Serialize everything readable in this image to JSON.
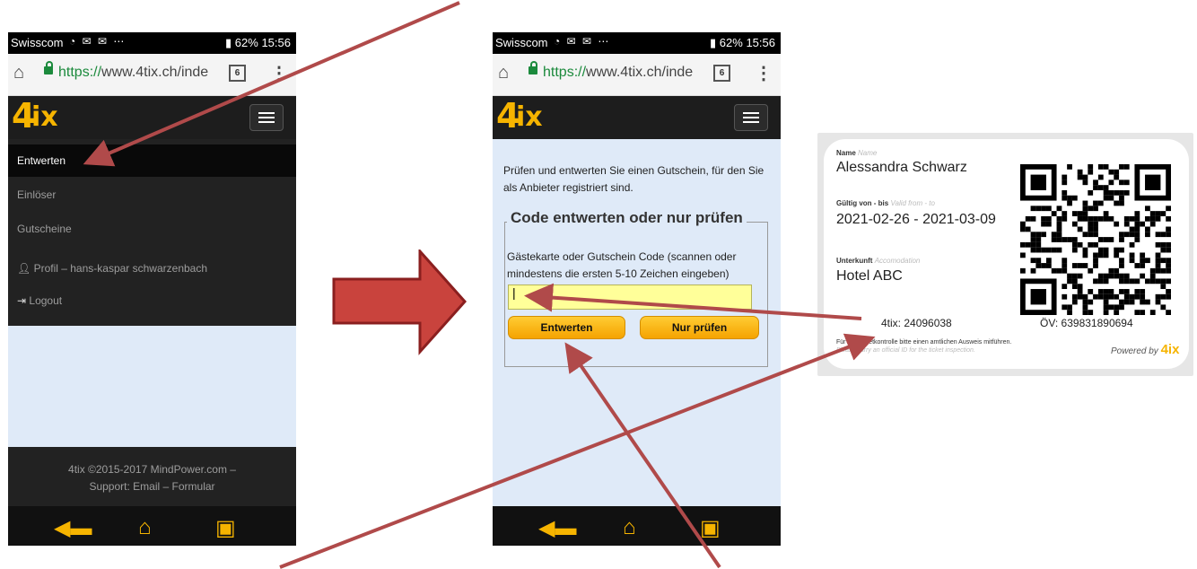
{
  "colors": {
    "accent": "#f6b400",
    "dark_nav": "#222222",
    "content_bg": "#dfeaf8",
    "arrow_red": "#b04a4a",
    "input_yellow": "#ffff99"
  },
  "left_phone": {
    "status": {
      "carrier": "Swisscom",
      "battery": "62%",
      "time": "15:56"
    },
    "browser": {
      "url_scheme": "https://",
      "url_host": "www.4tix.ch/inde",
      "tabs_count": "6"
    },
    "logo": {
      "four": "4",
      "ix": "ix"
    },
    "menu": {
      "items": [
        {
          "label": "Entwerten",
          "active": true
        },
        {
          "label": "Einlöser"
        },
        {
          "label": "Gutscheine"
        },
        {
          "label": "Profil – hans-kaspar schwarzenbach",
          "icon": "user-icon"
        },
        {
          "label": "Logout",
          "icon": "logout-icon"
        }
      ]
    },
    "footer": {
      "line1": "4tix ©2015-2017 MindPower.com –",
      "support": "Support:",
      "email": "Email",
      "sep": "–",
      "formular": "Formular"
    }
  },
  "right_phone": {
    "status": {
      "carrier": "Swisscom",
      "battery": "62%",
      "time": "15:56"
    },
    "browser": {
      "url_scheme": "https://",
      "url_host": "www.4tix.ch/inde",
      "tabs_count": "6"
    },
    "logo": {
      "four": "4",
      "ix": "ix"
    },
    "intro": "Prüfen und entwerten Sie einen Gutschein, für den Sie als Anbieter registriert sind.",
    "fieldset": {
      "legend": "Code entwerten oder nur prüfen",
      "description": "Gästekarte oder Gutschein Code (scannen oder mindestens die ersten 5-10 Zeichen eingeben)",
      "input_value": "|",
      "btn_entwerten": "Entwerten",
      "btn_nur_pruefen": "Nur prüfen"
    }
  },
  "ticket": {
    "name_label": "Name",
    "name_label_en": "Name",
    "name": "Alessandra Schwarz",
    "valid_label": "Gültig von - bis",
    "valid_label_en": "Valid from - to",
    "valid": "2021-02-26 - 2021-03-09",
    "accom_label": "Unterkunft",
    "accom_label_en": "Accomodation",
    "accom": "Hotel ABC",
    "tix_code": "4tix: 24096038",
    "oev_code": "ÖV: 639831890694",
    "notice_de": "Für die Ticketkontrolle bitte einen amtlichen Ausweis mitführen.",
    "notice_en": "Please carry an official ID for the ticket inspection.",
    "powered_by": "Powered by",
    "powered_logo": "4ix"
  }
}
